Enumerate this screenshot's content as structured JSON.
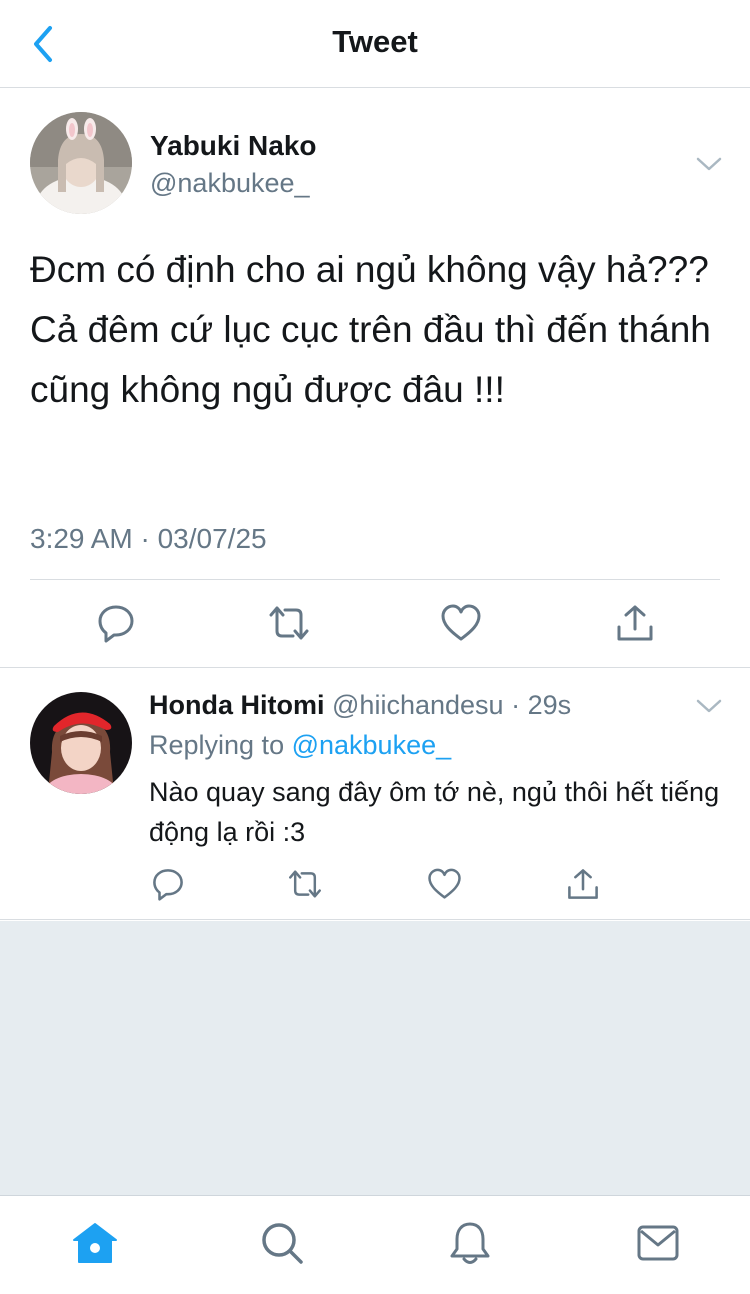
{
  "header": {
    "title": "Tweet"
  },
  "main_tweet": {
    "name": "Yabuki Nako",
    "handle": "@nakbukee_",
    "text": "Đcm có định cho ai ngủ không vậy hả??? Cả đêm cứ lục cục trên đầu thì đến thánh cũng không ngủ được đâu !!!",
    "timestamp": "3:29 AM · 03/07/25"
  },
  "reply": {
    "name": "Honda Hitomi",
    "handle": "@hiichandesu",
    "separator": "·",
    "time": "29s",
    "replying_prefix": "Replying to ",
    "replying_handle": "@nakbukee_",
    "text": "Nào quay sang đây ôm tớ nè, ngủ thôi hết tiếng động lạ rồi :3"
  },
  "icons": {
    "back": "chevron-left-icon",
    "caret": "chevron-down-icon",
    "reply": "reply-icon",
    "retweet": "retweet-icon",
    "like": "heart-icon",
    "share": "share-icon",
    "home": "home-icon",
    "search": "search-icon",
    "notifications": "bell-icon",
    "messages": "mail-icon"
  },
  "colors": {
    "accent": "#1da1f2",
    "text": "#14171a",
    "secondary": "#657786",
    "icon_gray": "#657786",
    "background_gray": "#e6ecf0"
  }
}
